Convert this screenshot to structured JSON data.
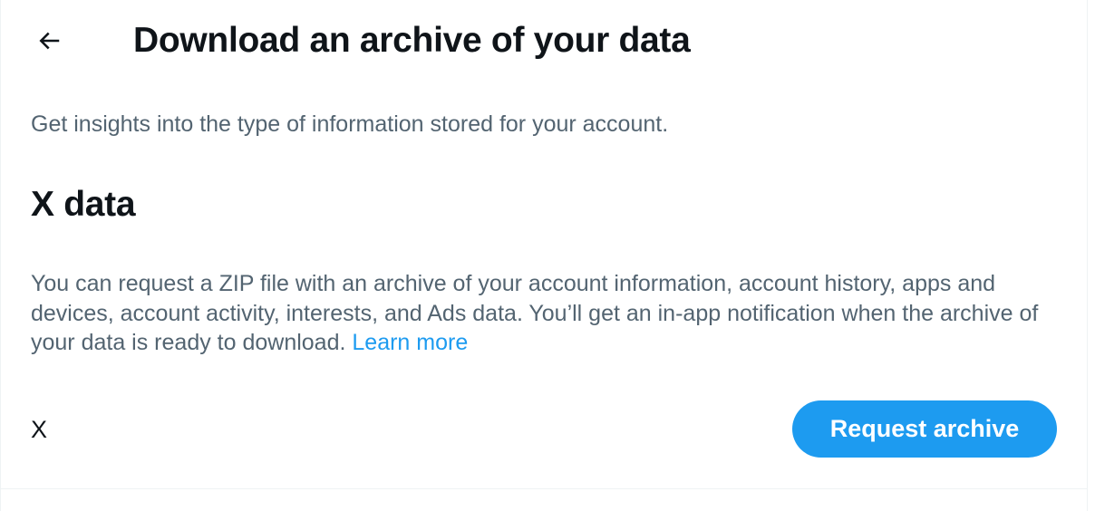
{
  "header": {
    "back_icon": "arrow-left-icon",
    "title": "Download an archive of your data"
  },
  "intro": "Get insights into the type of information stored for your account.",
  "section": {
    "heading": "X data",
    "description": "You can request a ZIP file with an archive of your account information, account history, apps and devices, account activity, interests, and Ads data. You’ll get an in-app notification when the archive of your data is ready to download.",
    "learn_more": "Learn more"
  },
  "account": {
    "name": "X",
    "button_label": "Request archive"
  },
  "colors": {
    "accent": "#1d9bf0",
    "primary_text": "#0f1419",
    "secondary_text": "#536471",
    "border": "#eff3f4"
  }
}
